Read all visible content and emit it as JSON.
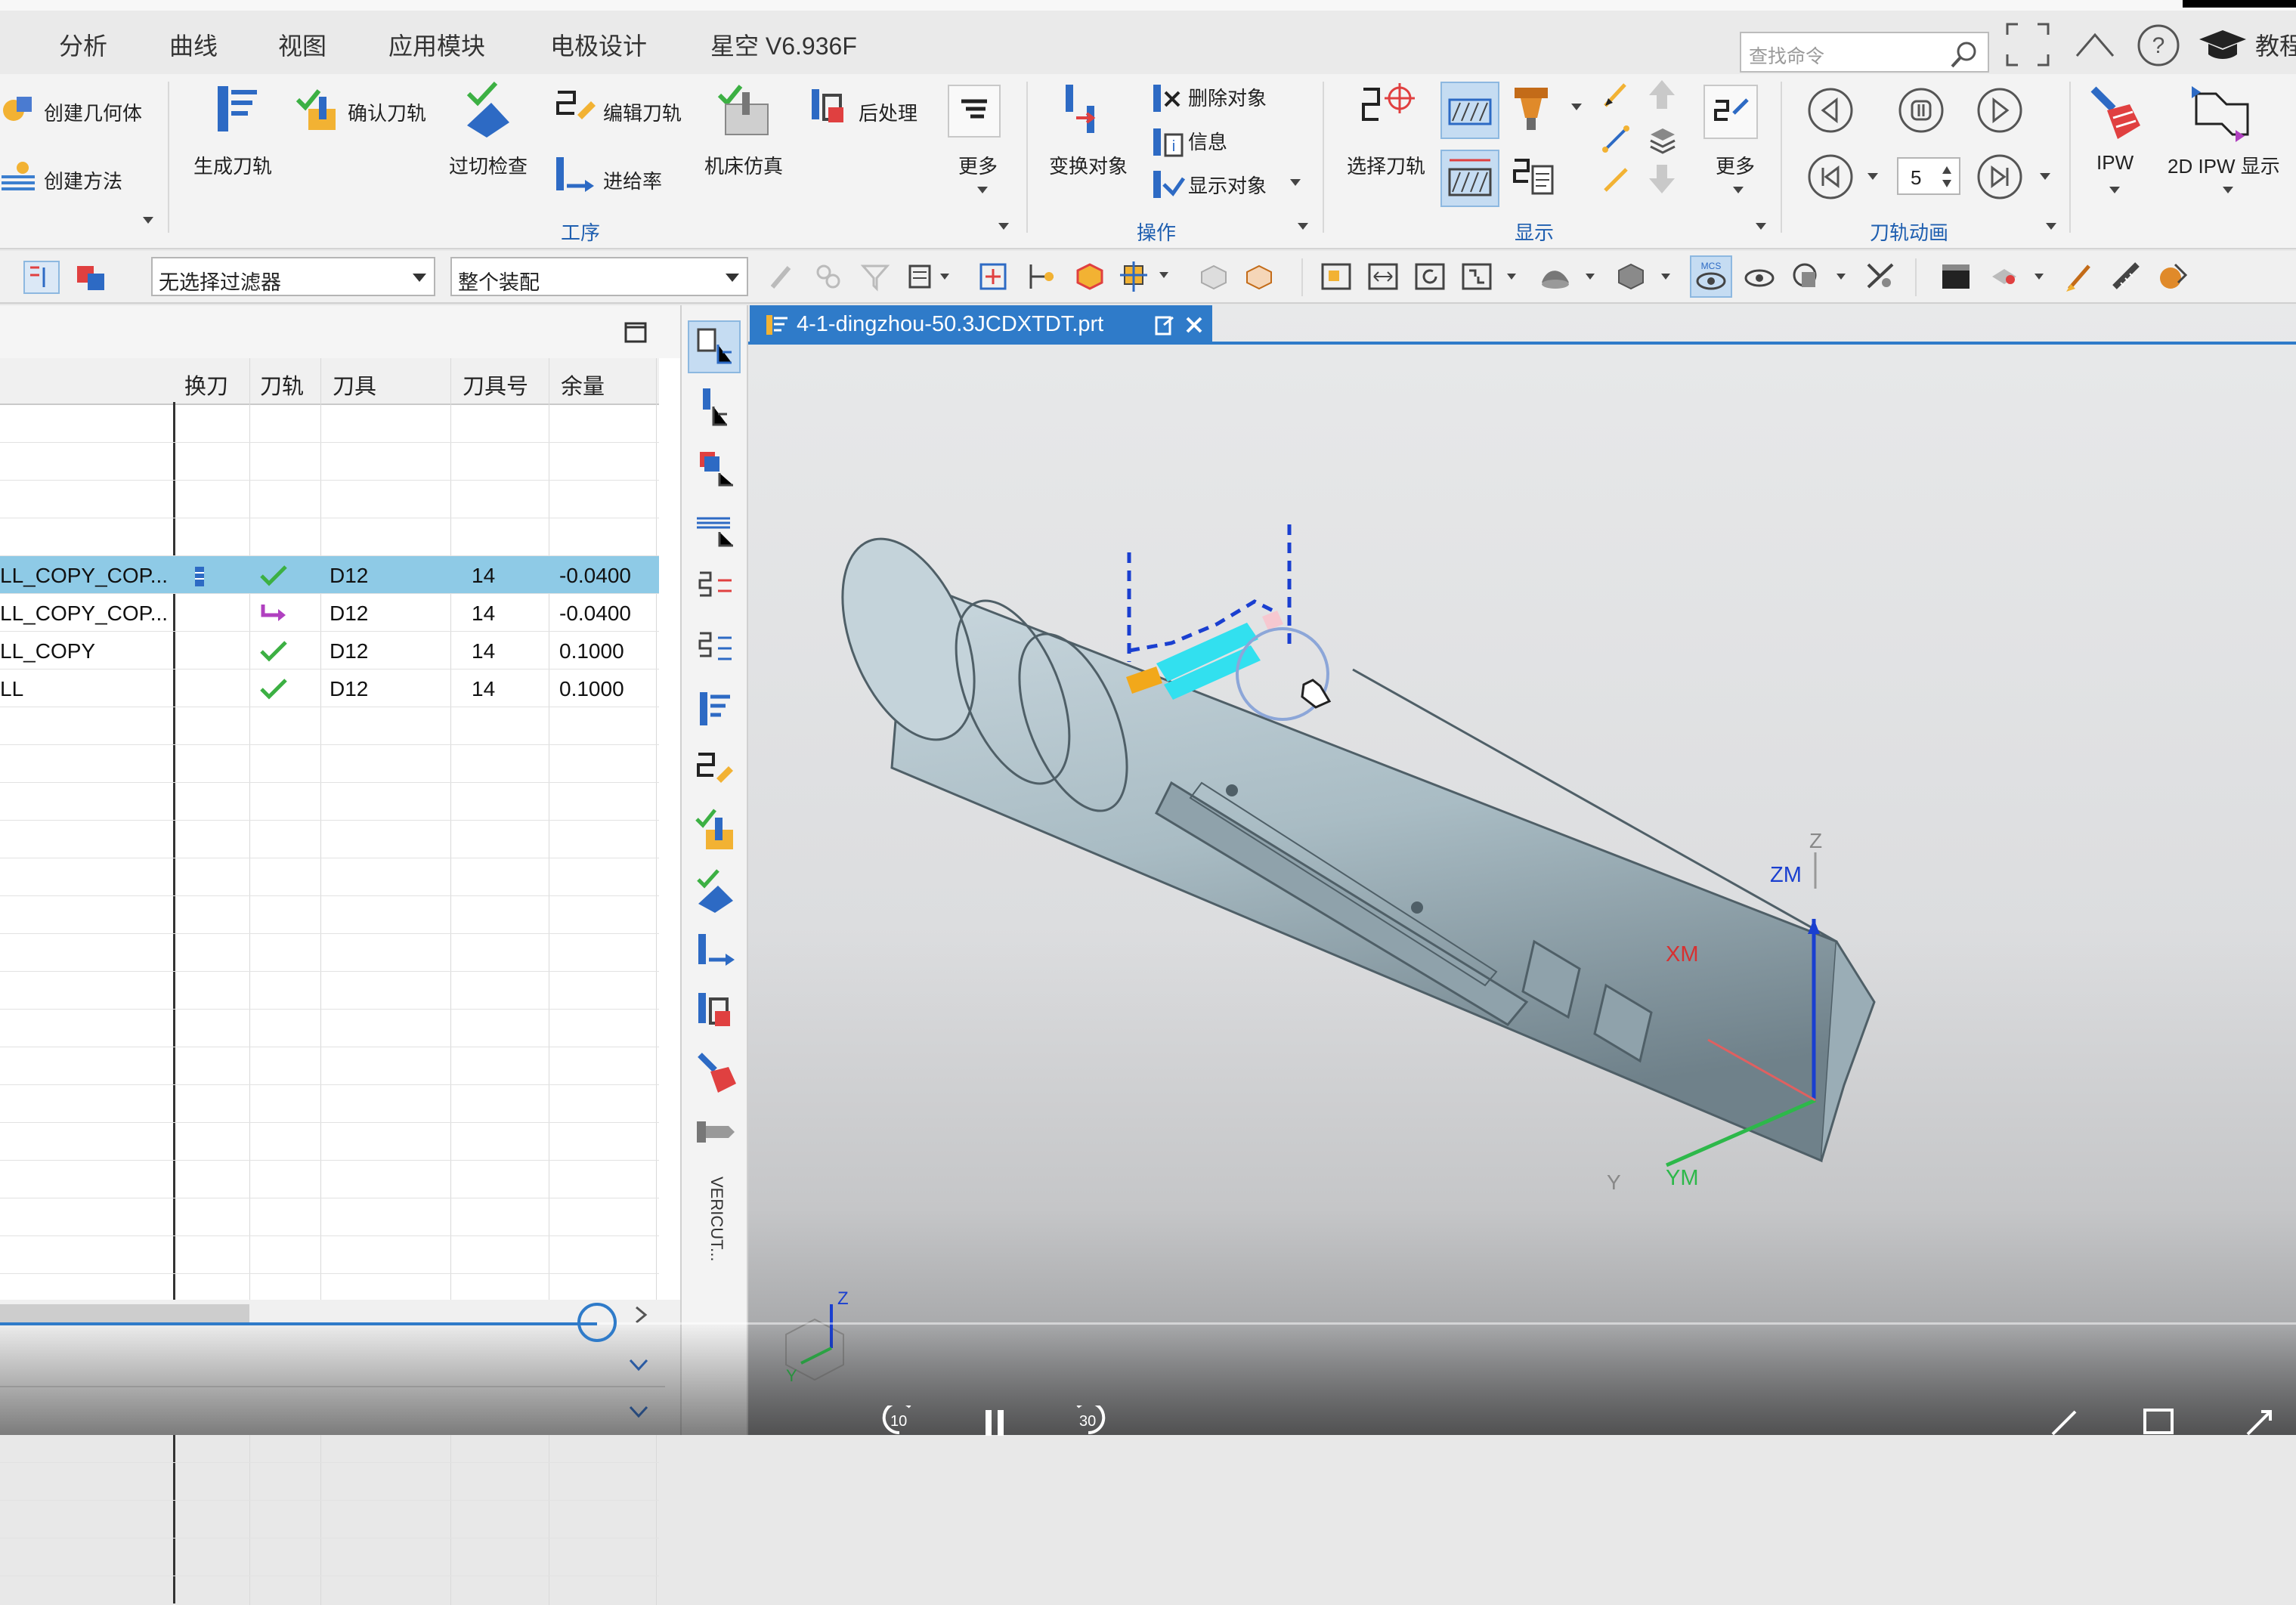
{
  "menu": {
    "items": [
      "分析",
      "曲线",
      "视图",
      "应用模块",
      "电极设计",
      "星空 V6.936F"
    ]
  },
  "search": {
    "placeholder": "查找命令"
  },
  "top_right": {
    "tutorial_label": "教程"
  },
  "ribbon": {
    "create_geometry": "创建几何体",
    "create_method": "创建方法",
    "generate_toolpath": "生成刀轨",
    "verify_toolpath": "确认刀轨",
    "gouge_check": "过切检查",
    "edit_toolpath": "编辑刀轨",
    "feed_rate": "进给率",
    "machine_simulation": "机床仿真",
    "postprocess": "后处理",
    "more_1": "更多",
    "group_process": "工序",
    "transform_object": "变换对象",
    "delete_object": "删除对象",
    "information": "信息",
    "display_object": "显示对象",
    "group_operation": "操作",
    "select_toolpath": "选择刀轨",
    "more_2": "更多",
    "group_display": "显示",
    "anim_step_value": "5",
    "group_animation": "刀轨动画",
    "ipw": "IPW",
    "ipw_2d": "2D IPW 显示"
  },
  "toolbar2": {
    "filter_select": "无选择过滤器",
    "assembly_select": "整个装配"
  },
  "nav_table": {
    "columns": [
      "换刀",
      "刀轨",
      "刀具",
      "刀具号",
      "余量"
    ],
    "rows": [
      {
        "name": "LL_COPY_COP...",
        "toolpath": "ok",
        "tool": "D12",
        "tool_no": "14",
        "stock": "-0.0400",
        "selected": true
      },
      {
        "name": "LL_COPY_COP...",
        "toolpath": "regen",
        "tool": "D12",
        "tool_no": "14",
        "stock": "-0.0400",
        "selected": false
      },
      {
        "name": "LL_COPY",
        "toolpath": "ok",
        "tool": "D12",
        "tool_no": "14",
        "stock": "0.1000",
        "selected": false
      },
      {
        "name": "LL",
        "toolpath": "ok",
        "tool": "D12",
        "tool_no": "14",
        "stock": "0.1000",
        "selected": false
      }
    ]
  },
  "side_toolbar": {
    "vericut_label": "VERICUT..."
  },
  "viewport": {
    "tab_title": "4-1-dingzhou-50.3JCDXTDT.prt",
    "csys_labels": {
      "z": "Z",
      "zm": "ZM",
      "xm": "XM",
      "y": "Y",
      "ym": "YM"
    },
    "triad_labels": {
      "z": "Z",
      "y": "Y"
    }
  },
  "player": {
    "rewind_label": "10",
    "forward_label": "30"
  },
  "colors": {
    "accent": "#2f7bc9",
    "selection": "#8ecae6",
    "ok_green": "#3cb043",
    "part": "#a9bcc4"
  }
}
